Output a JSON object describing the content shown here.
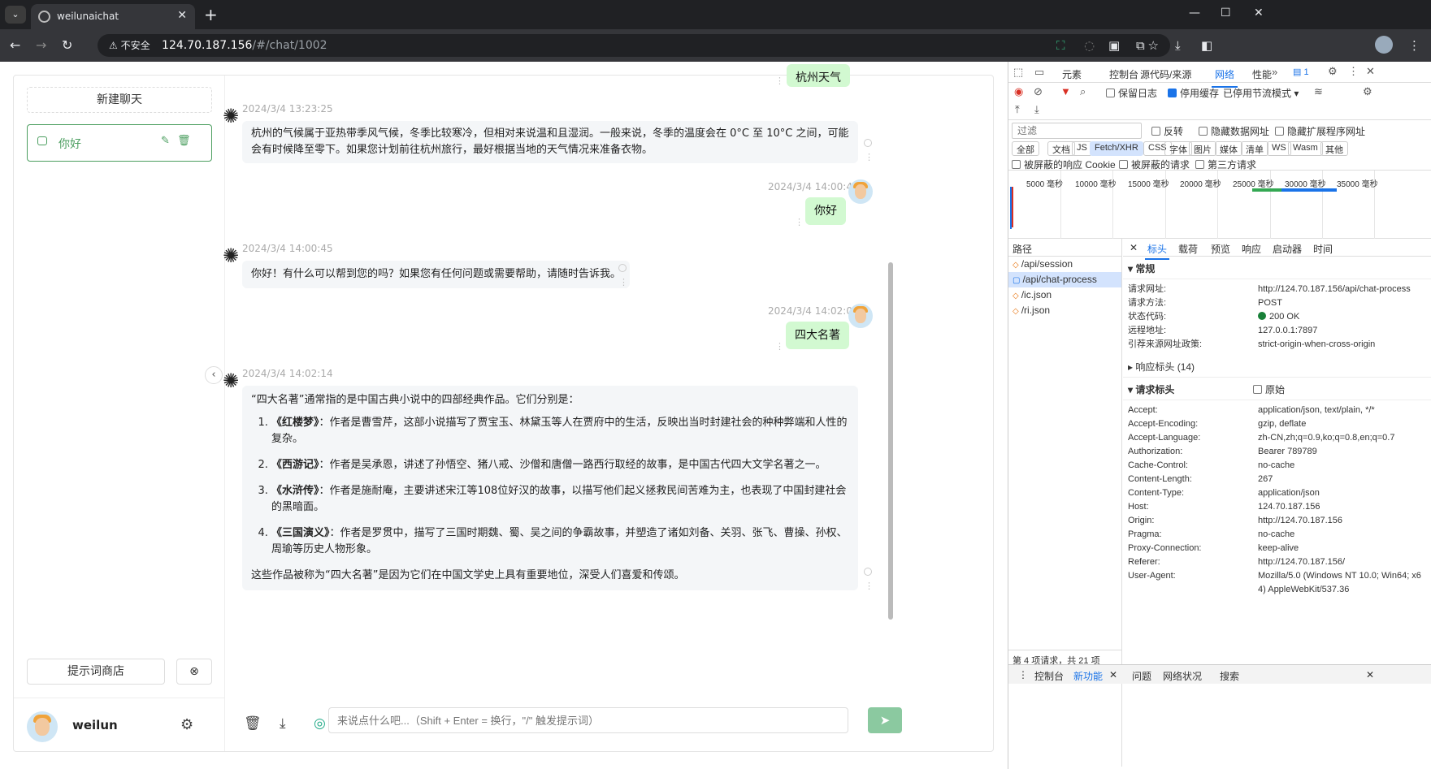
{
  "browser": {
    "tab_title": "weilunaichat",
    "insecure_label": "不安全",
    "url_host": "124.70.187.156",
    "url_path": "/#/chat/1002"
  },
  "sidebar": {
    "new_chat": "新建聊天",
    "chats": [
      {
        "title": "你好"
      }
    ],
    "prompt_store": "提示词商店",
    "username": "weilun"
  },
  "messages": [
    {
      "role": "assistant",
      "time": "2024/3/4 13:23:25",
      "text": "杭州的气候属于亚热带季风气候，冬季比较寒冷，但相对来说温和且湿润。一般来说，冬季的温度会在 0°C 至 10°C 之间，可能会有时候降至零下。如果您计划前往杭州旅行，最好根据当地的天气情况来准备衣物。"
    },
    {
      "role": "user",
      "time": "2024/3/4 14:00:44",
      "text": "你好"
    },
    {
      "role": "assistant",
      "time": "2024/3/4 14:00:45",
      "text": "你好！有什么可以帮到您的吗？如果您有任何问题或需要帮助，请随时告诉我。"
    },
    {
      "role": "user",
      "time": "2024/3/4 14:02:06",
      "text": "四大名著"
    },
    {
      "role": "assistant",
      "time": "2024/3/4 14:02:14",
      "intro": "“四大名著”通常指的是中国古典小说中的四部经典作品。它们分别是：",
      "items": [
        {
          "title": "《红楼梦》",
          "text": "：作者是曹雪芹，这部小说描写了贾宝玉、林黛玉等人在贾府中的生活，反映出当时封建社会的种种弊端和人性的复杂。"
        },
        {
          "title": "《西游记》",
          "text": "：作者是吴承恩，讲述了孙悟空、猪八戒、沙僧和唐僧一路西行取经的故事，是中国古代四大文学名著之一。"
        },
        {
          "title": "《水浒传》",
          "text": "：作者是施耐庵，主要讲述宋江等108位好汉的故事，以描写他们起义拯救民间苦难为主，也表现了中国封建社会的黑暗面。"
        },
        {
          "title": "《三国演义》",
          "text": "：作者是罗贯中，描写了三国时期魏、蜀、吴之间的争霸故事，并塑造了诸如刘备、关羽、张飞、曹操、孙权、周瑜等历史人物形象。"
        }
      ],
      "outro": "这些作品被称为“四大名著”是因为它们在中国文学史上具有重要地位，深受人们喜爱和传颂。"
    }
  ],
  "partial_top_message": "杭州天气",
  "input": {
    "placeholder": "来说点什么吧...（Shift + Enter = 换行，\"/\" 触发提示词）"
  },
  "devtools": {
    "tabs": [
      "元素",
      "控制台",
      "源代码/来源",
      "网络",
      "性能"
    ],
    "issue_count": "1",
    "preserve_log": "保留日志",
    "disable_cache": "停用缓存",
    "throttle": "已停用节流模式",
    "filter_placeholder": "过滤",
    "invert": "反转",
    "hide_data_urls": "隐藏数据网址",
    "hide_ext_urls": "隐藏扩展程序网址",
    "type_filters": [
      "全部",
      "文档",
      "JS",
      "Fetch/XHR",
      "CSS",
      "字体",
      "图片",
      "媒体",
      "清单",
      "WS",
      "Wasm",
      "其他"
    ],
    "blocked_cookies": "被屏蔽的响应 Cookie",
    "blocked_requests": "被屏蔽的请求",
    "third_party": "第三方请求",
    "timeline_ticks": [
      "5000 毫秒",
      "10000 毫秒",
      "15000 毫秒",
      "20000 毫秒",
      "25000 毫秒",
      "30000 毫秒",
      "35000 毫秒"
    ],
    "path_header": "路径",
    "requests": [
      "/api/session",
      "/api/chat-process",
      "/ic.json",
      "/ri.json"
    ],
    "footer_count": "第 4 项请求，共 21 项",
    "detail_tabs": [
      "标头",
      "载荷",
      "预览",
      "响应",
      "启动器",
      "时间"
    ],
    "general_title": "常规",
    "general": [
      {
        "k": "请求网址:",
        "v": "http://124.70.187.156/api/chat-process"
      },
      {
        "k": "请求方法:",
        "v": "POST"
      },
      {
        "k": "状态代码:",
        "v": "200 OK"
      },
      {
        "k": "远程地址:",
        "v": "127.0.0.1:7897"
      },
      {
        "k": "引荐来源网址政策:",
        "v": "strict-origin-when-cross-origin"
      }
    ],
    "response_headers": "响应标头 (14)",
    "request_headers_title": "请求标头",
    "raw_label": "原始",
    "request_headers": [
      {
        "k": "Accept:",
        "v": "application/json, text/plain, */*"
      },
      {
        "k": "Accept-Encoding:",
        "v": "gzip, deflate"
      },
      {
        "k": "Accept-Language:",
        "v": "zh-CN,zh;q=0.9,ko;q=0.8,en;q=0.7"
      },
      {
        "k": "Authorization:",
        "v": "Bearer 789789"
      },
      {
        "k": "Cache-Control:",
        "v": "no-cache"
      },
      {
        "k": "Content-Length:",
        "v": "267"
      },
      {
        "k": "Content-Type:",
        "v": "application/json"
      },
      {
        "k": "Host:",
        "v": "124.70.187.156"
      },
      {
        "k": "Origin:",
        "v": "http://124.70.187.156"
      },
      {
        "k": "Pragma:",
        "v": "no-cache"
      },
      {
        "k": "Proxy-Connection:",
        "v": "keep-alive"
      },
      {
        "k": "Referer:",
        "v": "http://124.70.187.156/"
      },
      {
        "k": "User-Agent:",
        "v": "Mozilla/5.0 (Windows NT 10.0; Win64; x64) AppleWebKit/537.36"
      }
    ],
    "drawer_tabs": [
      "控制台",
      "新功能",
      "问题",
      "网络状况",
      "搜索"
    ]
  }
}
